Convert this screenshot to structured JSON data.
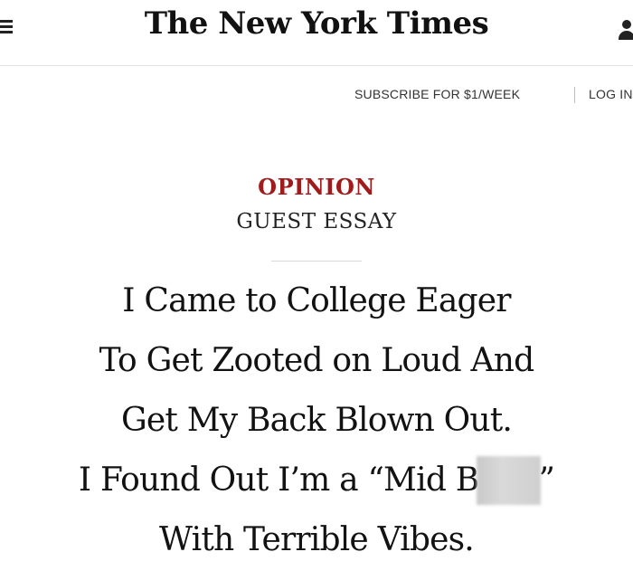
{
  "header": {
    "masthead": "The New York Times",
    "menu_icon": "hamburger-menu-icon",
    "account_icon": "account-icon"
  },
  "subnav": {
    "subscribe": "SUBSCRIBE FOR $1/WEEK",
    "login": "LOG IN"
  },
  "article": {
    "kicker": "OPINION",
    "subkicker": "GUEST ESSAY",
    "headline_lines": [
      "I Came to College Eager",
      "To Get Zooted on Loud And",
      "Get My Back Blown Out.",
      "I Found Out I’m a “Mid B",
      "With Terrible Vibes."
    ],
    "headline_line4_censored": "itch",
    "headline_line4_end": "”"
  },
  "colors": {
    "kicker": "#a11a1c",
    "text": "#121212",
    "divider": "#e2e2e2"
  }
}
